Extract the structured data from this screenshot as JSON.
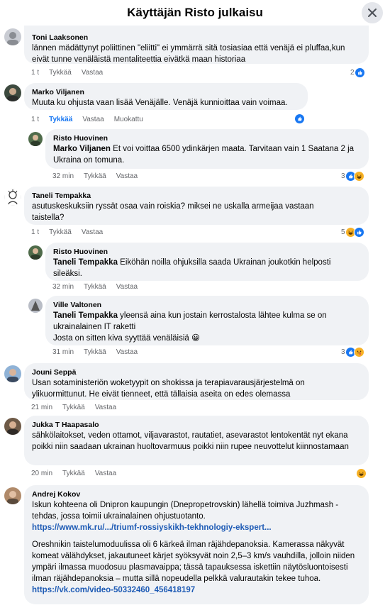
{
  "header": {
    "title": "Käyttäjän Risto julkaisu"
  },
  "comments": [
    {
      "author": "Toni Laaksonen",
      "text": "lännen mädättynyt poliittinen \"eliitti\" ei ymmärrä sitä tosiasiaa että venäjä ei pluffaa,kun eivät tunne venäläistä mentaliteettia eivätkä maan historiaa",
      "time": "1 t",
      "like": "Tykkää",
      "reply": "Vastaa",
      "reaction_count": "2"
    },
    {
      "author": "Marko Viljanen",
      "text": "Muuta ku ohjusta vaan lisää Venäjälle. Venäjä kunnioittaa vain voimaa.",
      "time": "1 t",
      "like": "Tykkää",
      "reply": "Vastaa",
      "edited": "Muokattu"
    },
    {
      "author": "Risto Huovinen",
      "mention": "Marko Viljanen",
      "text": " Et voi voittaa 6500 ydinkärjen maata. Tarvitaan vain 1 Saatana 2 ja Ukraina on tomuna.",
      "time": "32 min",
      "like": "Tykkää",
      "reply": "Vastaa",
      "reaction_count": "3"
    },
    {
      "author": "Taneli Tempakka",
      "text": "asutuskeskuksiin ryssät osaa vain roiskia? miksei ne uskalla armeijaa vastaan taistella?",
      "time": "1 t",
      "like": "Tykkää",
      "reply": "Vastaa",
      "reaction_count": "5"
    },
    {
      "author": "Risto Huovinen",
      "mention": "Taneli Tempakka",
      "text": " Eiköhän noilla ohjuksilla saada Ukrainan joukotkin helposti sileäksi.",
      "time": "32 min",
      "like": "Tykkää",
      "reply": "Vastaa"
    },
    {
      "author": "Ville Valtonen",
      "mention": "Taneli Tempakka",
      "text": " yleensä aina kun jostain kerrostalosta lähtee kulma se on ukrainalainen IT raketti\nJosta on sitten kiva syyttää venäläisiä 😀",
      "time": "31 min",
      "like": "Tykkää",
      "reply": "Vastaa",
      "reaction_count": "3"
    },
    {
      "author": "Jouni Seppä",
      "text": "Usan sotaministeriön woketyypit on shokissa ja terapiavarausjärjestelmä on ylikuormittunut. He eivät tienneet, että tällaisia aseita on edes olemassa",
      "time": "21 min",
      "like": "Tykkää",
      "reply": "Vastaa"
    },
    {
      "author": "Jukka T Haapasalo",
      "text": "sähkölaitokset, veden ottamot, viljavarastot, rautatiet, asevarastot lentokentät nyt ekana poikki niin saadaan ukrainan huoltovarmuus poikki niin rupee neuvottelut kiinnostamaan",
      "time": "20 min",
      "like": "Tykkää",
      "reply": "Vastaa"
    },
    {
      "author": "Andrej Kokov",
      "text1": "Iskun kohteena oli Dnipron kaupungin (Dnepropetrovskin) lähellä toimiva Juzhmash -tehdas, jossa toimii ukrainalainen ohjustuotanto.",
      "link1": "https://www.mk.ru/.../triumf-rossiyskikh-tekhnologiy-ekspert...",
      "text2": "Oreshnikin taistelumoduulissa oli 6 kärkeä ilman räjähdepanoksia. Kamerassa näkyvät komeat välähdykset, jakautuneet kärjet syöksyvät noin 2,5–3 km/s vauhdilla, jolloin niiden ympäri ilmassa muodosuu plasmavaippa; tässä tapauksessa iskettiin näytösluontoisesti ilman räjähdepanoksia – mutta sillä nopeudella pelkkä valurautakin tekee tuhoa.",
      "link2": "https://vk.com/video-50332460_456418197"
    }
  ],
  "colors": {
    "like": "#1877f2",
    "bubble": "#f0f2f5",
    "link": "#1e5bb5"
  }
}
